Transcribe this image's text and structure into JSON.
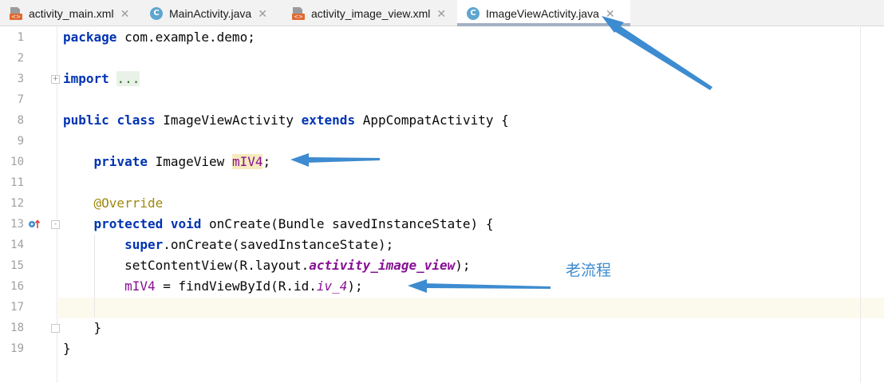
{
  "tabs": [
    {
      "label": "activity_main.xml",
      "icon": "xml-layout-icon",
      "active": false
    },
    {
      "label": "MainActivity.java",
      "icon": "java-class-icon",
      "active": false
    },
    {
      "label": "activity_image_view.xml",
      "icon": "xml-layout-icon",
      "active": false
    },
    {
      "label": "ImageViewActivity.java",
      "icon": "java-class-icon",
      "active": true
    }
  ],
  "icons": {
    "xml_badge": "<>",
    "java_badge": "C",
    "close": "✕",
    "fold_plus": "+",
    "fold_minus": "-"
  },
  "line_numbers": [
    "1",
    "2",
    "3",
    "7",
    "8",
    "9",
    "10",
    "11",
    "12",
    "13",
    "14",
    "15",
    "16",
    "17",
    "18",
    "19"
  ],
  "code": {
    "l1_kw": "package",
    "l1_rest": " com.example.demo;",
    "l3_kw": "import",
    "l3_folded": "...",
    "l8_kw1": "public",
    "l8_kw2": "class",
    "l8_mid": " ImageViewActivity ",
    "l8_kw3": "extends",
    "l8_rest": " AppCompatActivity {",
    "l10_kw": "private",
    "l10_mid": " ImageView ",
    "l10_field": "mIV4",
    "l10_end": ";",
    "l12_ann": "@Override",
    "l13_kw1": "protected",
    "l13_kw2": "void",
    "l13_rest": " onCreate(Bundle savedInstanceState) {",
    "l14_kw": "super",
    "l14_rest": ".onCreate(savedInstanceState);",
    "l15_pre": "setContentView(R.layout.",
    "l15_ref": "activity_image_view",
    "l15_end": ");",
    "l16_field": "mIV4",
    "l16_mid": " = findViewById(R.id.",
    "l16_ref": "iv_4",
    "l16_end": ");",
    "l18": "}",
    "l19": "}"
  },
  "annotation": {
    "text": "老流程",
    "color": "#3d8bd0"
  },
  "colors": {
    "keyword": "#0033b3",
    "annotation": "#9e880d",
    "field": "#871094",
    "current_line": "#fcfaed",
    "arrow": "#3d8bd0"
  }
}
